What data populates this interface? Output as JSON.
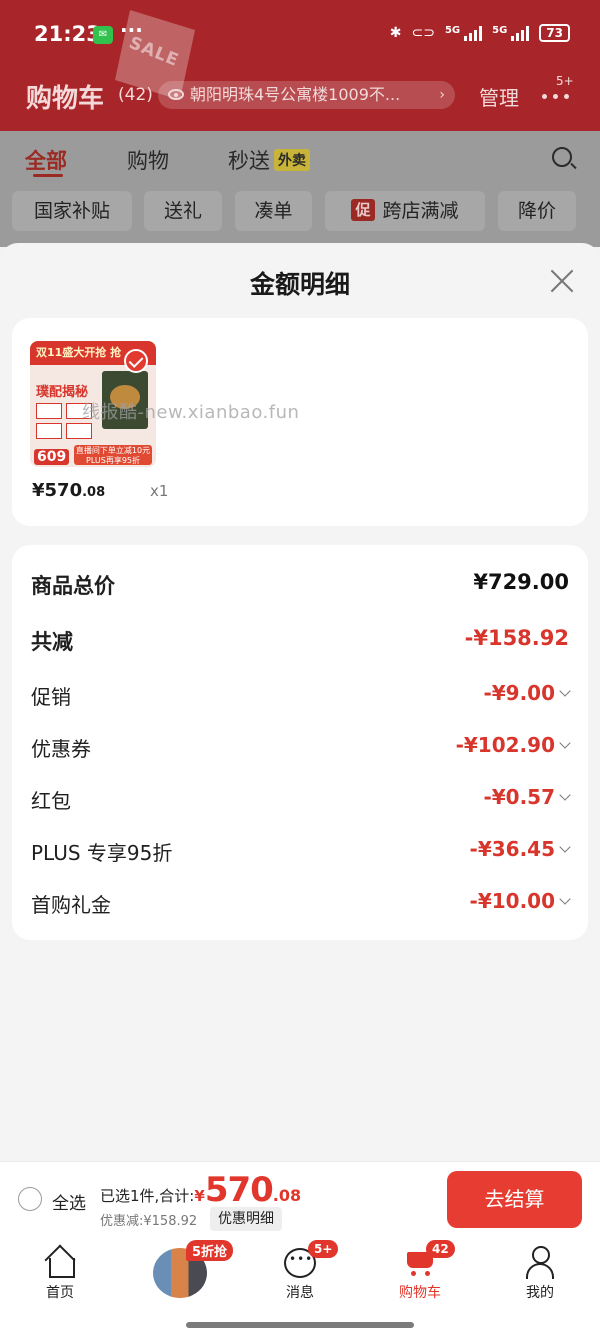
{
  "status_bar": {
    "time": "21:23",
    "more": "···",
    "net1": "5G",
    "net2": "5G",
    "battery": "73"
  },
  "header": {
    "title": "购物车",
    "count": "(42)",
    "address": "朝阳明珠4号公寓楼1009不...",
    "manage": "管理",
    "more_badge": "5+",
    "deco_text": "SALE"
  },
  "tabs": [
    {
      "label": "全部"
    },
    {
      "label": "购物"
    },
    {
      "label": "秒送",
      "tag": "外卖"
    }
  ],
  "filters": [
    {
      "label": "国家补贴"
    },
    {
      "label": "送礼"
    },
    {
      "label": "凑单"
    },
    {
      "label": "跨店满减",
      "badge": "促"
    },
    {
      "label": "降价"
    }
  ],
  "sheet": {
    "title": "金额明细",
    "product": {
      "price_int": "¥570",
      "price_dec": ".08",
      "qty": "x1",
      "img_text": {
        "top": "双11盛大开抢 抢",
        "mid": "璞配揭秘",
        "price": "609",
        "banner1": "直播间下单立减10元",
        "banner2": "PLUS再享95折"
      }
    },
    "watermark": "线报酷-new.xianbao.fun",
    "rows": [
      {
        "label": "商品总价",
        "value": "¥729.00"
      },
      {
        "label": "共减",
        "value": "-¥158.92"
      },
      {
        "label": "促销",
        "value": "-¥9.00"
      },
      {
        "label": "优惠券",
        "value": "-¥102.90"
      },
      {
        "label": "红包",
        "value": "-¥0.57"
      },
      {
        "label": "PLUS 专享95折",
        "value": "-¥36.45"
      },
      {
        "label": "首购礼金",
        "value": "-¥10.00"
      }
    ]
  },
  "checkout": {
    "select_all": "全选",
    "selected_text": "已选1件,合计:",
    "yen": "¥",
    "total_int": "570",
    "total_dec": ".08",
    "discount": "优惠减:¥158.92",
    "detail_btn": "优惠明细",
    "submit": "去结算"
  },
  "nav": {
    "home": "首页",
    "promo_badge": "5折抢",
    "messages": "消息",
    "messages_badge": "5+",
    "cart": "购物车",
    "cart_badge": "42",
    "me": "我的"
  },
  "colors": {
    "accent": "#e1362b",
    "header_bg": "#a8262a"
  }
}
